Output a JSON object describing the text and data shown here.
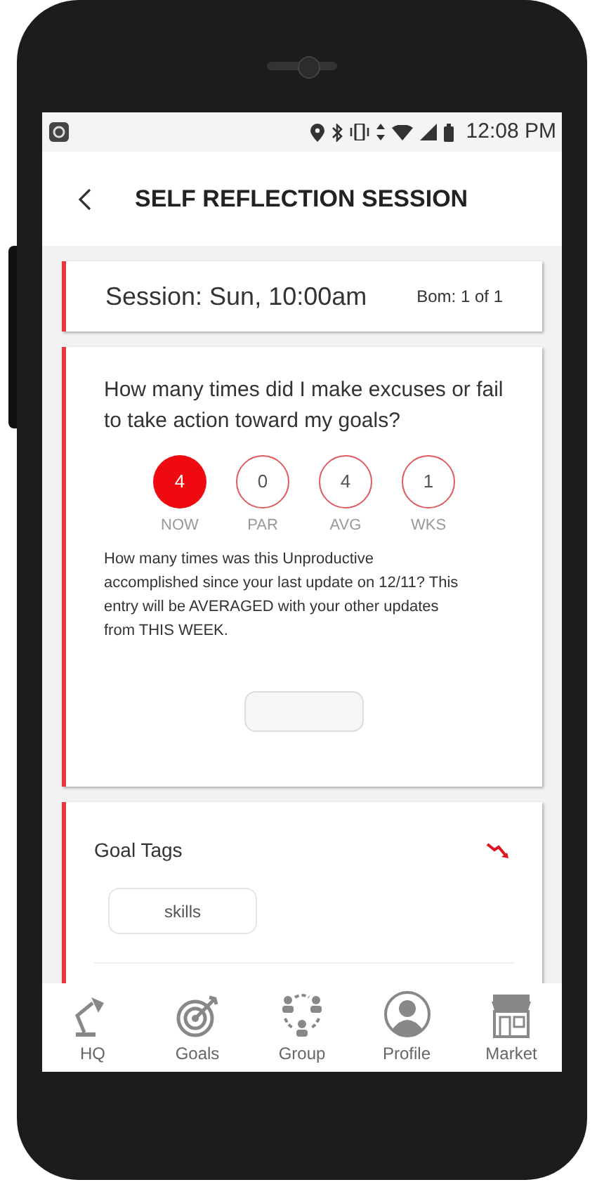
{
  "status_bar": {
    "time": "12:08 PM"
  },
  "header": {
    "title": "SELF REFLECTION SESSION"
  },
  "session_card": {
    "title": "Session: Sun, 10:00am",
    "counter": "Bom: 1 of 1"
  },
  "question_card": {
    "question": "How many times did I make excuses or fail to take action toward my goals?",
    "metrics": [
      {
        "value": "4",
        "label": "NOW",
        "selected": true
      },
      {
        "value": "0",
        "label": "PAR",
        "selected": false
      },
      {
        "value": "4",
        "label": "AVG",
        "selected": false
      },
      {
        "value": "1",
        "label": "WKS",
        "selected": false
      }
    ],
    "description": "How many times was this Unproductive accomplished since your last update on 12/11? This entry will be AVERAGED with your other updates from THIS WEEK."
  },
  "tags_card": {
    "title": "Goal Tags",
    "tags": [
      "skills"
    ]
  },
  "bottom_nav": [
    {
      "label": "HQ"
    },
    {
      "label": "Goals"
    },
    {
      "label": "Group"
    },
    {
      "label": "Profile"
    },
    {
      "label": "Market"
    }
  ]
}
